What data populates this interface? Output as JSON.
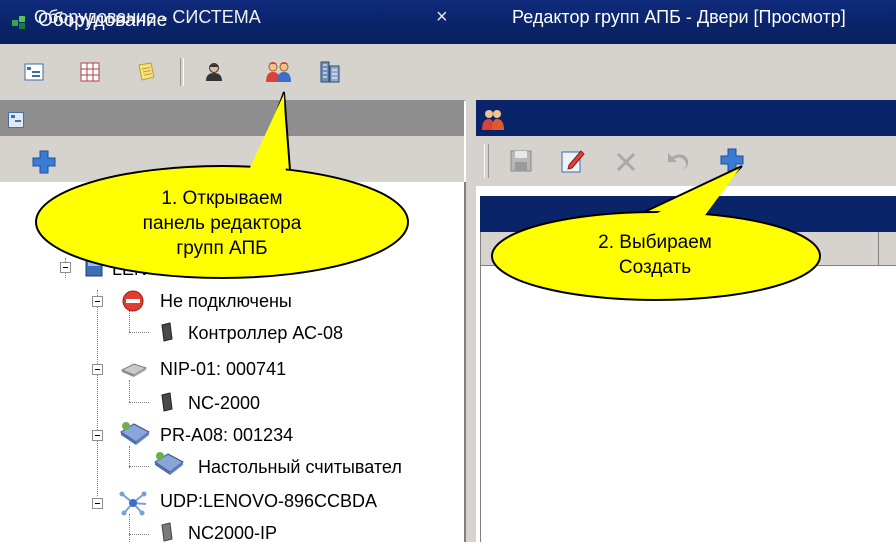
{
  "window": {
    "title": "Оборудование"
  },
  "left_panel": {
    "title": "Оборудование - СИСТЕМА",
    "close_glyph": "×",
    "tree": [
      {
        "label": "LENOVO-896CCBDA",
        "icon": "computer-icon",
        "level": 0
      },
      {
        "label": "Не подключены",
        "icon": "no-entry-icon",
        "level": 1
      },
      {
        "label": "Контроллер АС-08",
        "icon": "controller-icon",
        "level": 2
      },
      {
        "label": "NIP-01: 000741",
        "icon": "network-device-icon",
        "level": 1
      },
      {
        "label": "NC-2000",
        "icon": "controller-icon",
        "level": 2
      },
      {
        "label": "PR-A08: 001234",
        "icon": "reader-icon",
        "level": 1
      },
      {
        "label": "Настольный считывател",
        "icon": "reader-icon",
        "level": 2
      },
      {
        "label": "UDP:LENOVO-896CCBDA",
        "icon": "network-icon",
        "level": 1
      },
      {
        "label": "NC2000-IP",
        "icon": "controller-icon",
        "level": 2
      }
    ]
  },
  "right_panel": {
    "title": "Редактор групп АПБ - Двери [Просмотр]",
    "toolbar": [
      "save-icon",
      "edit-icon",
      "delete-icon",
      "undo-icon",
      "add-icon"
    ]
  },
  "callouts": {
    "one_line1": "1. Открываем",
    "one_line2": "панель редактора",
    "one_line3": "групп АПБ",
    "two_line1": "2. Выбираем",
    "two_line2": "Создать"
  },
  "colors": {
    "title_bar": "#0a246a",
    "panel_face": "#d6d3ce",
    "inactive_header": "#8e8e8e",
    "callout_fill": "#ffff00",
    "accent_plus": "#3a7bd5"
  }
}
